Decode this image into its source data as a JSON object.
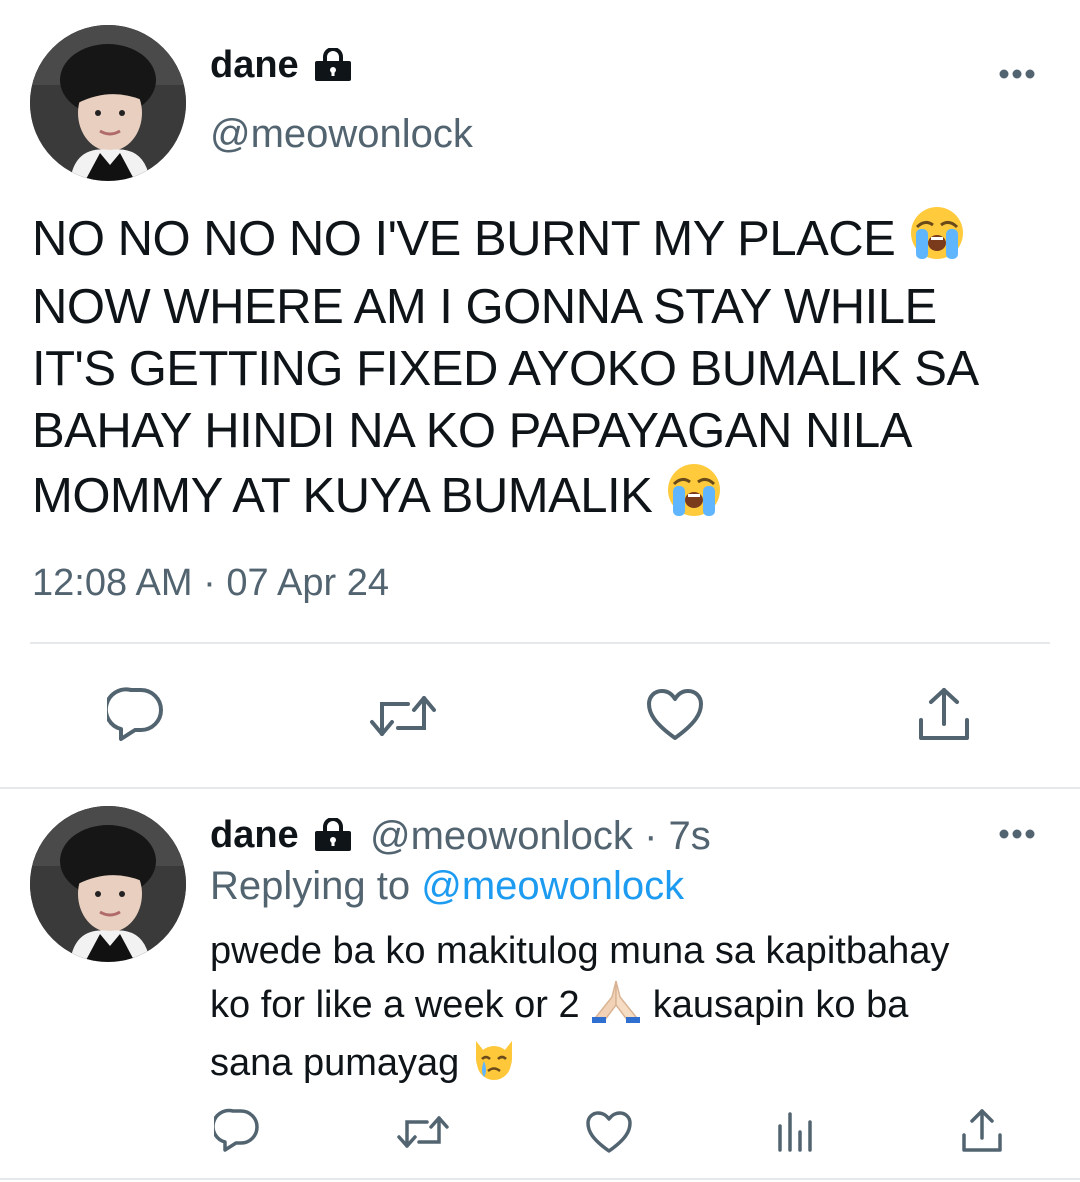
{
  "tweet": {
    "display_name": "dane",
    "handle": "@meowonlock",
    "text_lines": [
      "NO NO NO NO I'VE BURNT MY PLACE",
      "NOW WHERE AM I GONNA STAY WHILE",
      "IT'S GETTING FIXED AYOKO BUMALIK SA",
      "BAHAY HINDI NA KO PAPAYAGAN NILA",
      "MOMMY AT KUYA BUMALIK"
    ],
    "timestamp": "12:08 AM · 07 Apr 24"
  },
  "reply": {
    "display_name": "dane",
    "handle": "@meowonlock",
    "time_sep": "·",
    "time": "7s",
    "replying_prefix": "Replying to ",
    "replying_handle": "@meowonlock",
    "text_lines": [
      "pwede ba ko makitulog muna sa kapitbahay",
      "ko for like a week or 2",
      "kausapin ko ba",
      "sana pumayag"
    ]
  },
  "icons": {
    "lock": "lock-icon",
    "more": "more-icon",
    "reply": "reply-icon",
    "retweet": "retweet-icon",
    "like": "like-icon",
    "share": "share-icon",
    "analytics": "analytics-icon",
    "crying_face": "crying-face-emoji",
    "folded_hands": "folded-hands-emoji",
    "crying_cat": "crying-cat-emoji"
  },
  "colors": {
    "text": "#0f1419",
    "muted": "#536471",
    "link": "#1d9bf0",
    "divider": "#e6e9eb"
  }
}
